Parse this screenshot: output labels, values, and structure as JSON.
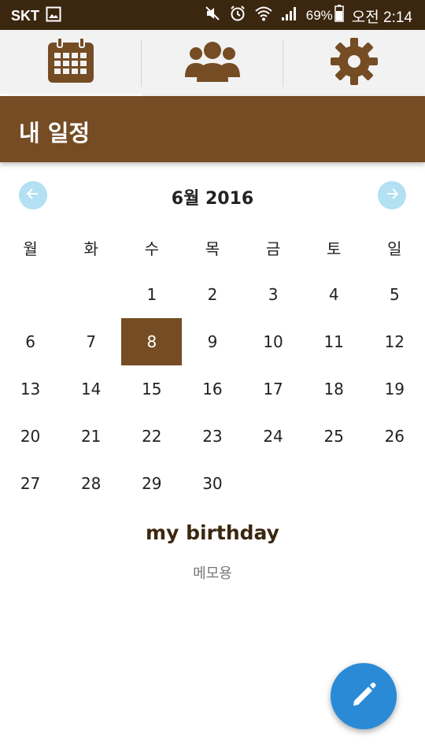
{
  "status_bar": {
    "carrier": "SKT",
    "battery": "69%",
    "time": "오전 2:14"
  },
  "tabs": [
    {
      "icon": "calendar-icon",
      "active": true
    },
    {
      "icon": "group-icon",
      "active": false
    },
    {
      "icon": "gear-icon",
      "active": false
    }
  ],
  "header": {
    "title": "내 일정"
  },
  "calendar": {
    "month_label": "6월 2016",
    "weekdays": [
      "월",
      "화",
      "수",
      "목",
      "금",
      "토",
      "일"
    ],
    "leading_blanks": 2,
    "days": [
      "1",
      "2",
      "3",
      "4",
      "5",
      "6",
      "7",
      "8",
      "9",
      "10",
      "11",
      "12",
      "13",
      "14",
      "15",
      "16",
      "17",
      "18",
      "19",
      "20",
      "21",
      "22",
      "23",
      "24",
      "25",
      "26",
      "27",
      "28",
      "29",
      "30"
    ],
    "selected_day": "8"
  },
  "event": {
    "title": "my birthday",
    "memo": "메모용"
  },
  "colors": {
    "brand_brown": "#754c24",
    "status_bar": "#3b2710",
    "nav_button": "#b3e0f2",
    "fab": "#2a8ad6"
  },
  "fab": {
    "icon": "pencil-icon"
  }
}
